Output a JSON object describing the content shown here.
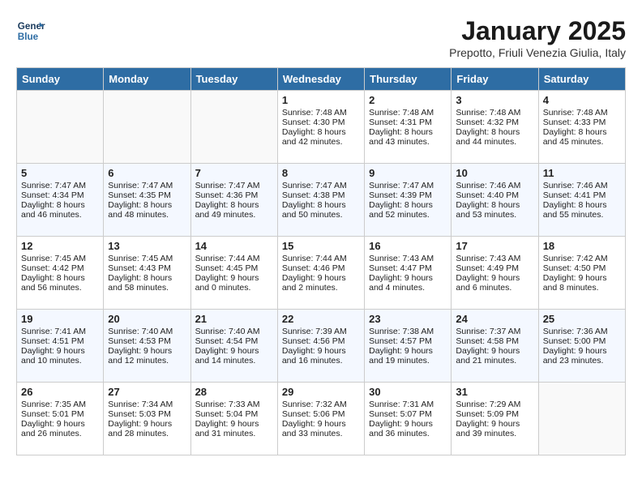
{
  "header": {
    "logo_line1": "General",
    "logo_line2": "Blue",
    "month": "January 2025",
    "location": "Prepotto, Friuli Venezia Giulia, Italy"
  },
  "days_of_week": [
    "Sunday",
    "Monday",
    "Tuesday",
    "Wednesday",
    "Thursday",
    "Friday",
    "Saturday"
  ],
  "weeks": [
    [
      {
        "day": "",
        "content": ""
      },
      {
        "day": "",
        "content": ""
      },
      {
        "day": "",
        "content": ""
      },
      {
        "day": "1",
        "content": "Sunrise: 7:48 AM\nSunset: 4:30 PM\nDaylight: 8 hours and 42 minutes."
      },
      {
        "day": "2",
        "content": "Sunrise: 7:48 AM\nSunset: 4:31 PM\nDaylight: 8 hours and 43 minutes."
      },
      {
        "day": "3",
        "content": "Sunrise: 7:48 AM\nSunset: 4:32 PM\nDaylight: 8 hours and 44 minutes."
      },
      {
        "day": "4",
        "content": "Sunrise: 7:48 AM\nSunset: 4:33 PM\nDaylight: 8 hours and 45 minutes."
      }
    ],
    [
      {
        "day": "5",
        "content": "Sunrise: 7:47 AM\nSunset: 4:34 PM\nDaylight: 8 hours and 46 minutes."
      },
      {
        "day": "6",
        "content": "Sunrise: 7:47 AM\nSunset: 4:35 PM\nDaylight: 8 hours and 48 minutes."
      },
      {
        "day": "7",
        "content": "Sunrise: 7:47 AM\nSunset: 4:36 PM\nDaylight: 8 hours and 49 minutes."
      },
      {
        "day": "8",
        "content": "Sunrise: 7:47 AM\nSunset: 4:38 PM\nDaylight: 8 hours and 50 minutes."
      },
      {
        "day": "9",
        "content": "Sunrise: 7:47 AM\nSunset: 4:39 PM\nDaylight: 8 hours and 52 minutes."
      },
      {
        "day": "10",
        "content": "Sunrise: 7:46 AM\nSunset: 4:40 PM\nDaylight: 8 hours and 53 minutes."
      },
      {
        "day": "11",
        "content": "Sunrise: 7:46 AM\nSunset: 4:41 PM\nDaylight: 8 hours and 55 minutes."
      }
    ],
    [
      {
        "day": "12",
        "content": "Sunrise: 7:45 AM\nSunset: 4:42 PM\nDaylight: 8 hours and 56 minutes."
      },
      {
        "day": "13",
        "content": "Sunrise: 7:45 AM\nSunset: 4:43 PM\nDaylight: 8 hours and 58 minutes."
      },
      {
        "day": "14",
        "content": "Sunrise: 7:44 AM\nSunset: 4:45 PM\nDaylight: 9 hours and 0 minutes."
      },
      {
        "day": "15",
        "content": "Sunrise: 7:44 AM\nSunset: 4:46 PM\nDaylight: 9 hours and 2 minutes."
      },
      {
        "day": "16",
        "content": "Sunrise: 7:43 AM\nSunset: 4:47 PM\nDaylight: 9 hours and 4 minutes."
      },
      {
        "day": "17",
        "content": "Sunrise: 7:43 AM\nSunset: 4:49 PM\nDaylight: 9 hours and 6 minutes."
      },
      {
        "day": "18",
        "content": "Sunrise: 7:42 AM\nSunset: 4:50 PM\nDaylight: 9 hours and 8 minutes."
      }
    ],
    [
      {
        "day": "19",
        "content": "Sunrise: 7:41 AM\nSunset: 4:51 PM\nDaylight: 9 hours and 10 minutes."
      },
      {
        "day": "20",
        "content": "Sunrise: 7:40 AM\nSunset: 4:53 PM\nDaylight: 9 hours and 12 minutes."
      },
      {
        "day": "21",
        "content": "Sunrise: 7:40 AM\nSunset: 4:54 PM\nDaylight: 9 hours and 14 minutes."
      },
      {
        "day": "22",
        "content": "Sunrise: 7:39 AM\nSunset: 4:56 PM\nDaylight: 9 hours and 16 minutes."
      },
      {
        "day": "23",
        "content": "Sunrise: 7:38 AM\nSunset: 4:57 PM\nDaylight: 9 hours and 19 minutes."
      },
      {
        "day": "24",
        "content": "Sunrise: 7:37 AM\nSunset: 4:58 PM\nDaylight: 9 hours and 21 minutes."
      },
      {
        "day": "25",
        "content": "Sunrise: 7:36 AM\nSunset: 5:00 PM\nDaylight: 9 hours and 23 minutes."
      }
    ],
    [
      {
        "day": "26",
        "content": "Sunrise: 7:35 AM\nSunset: 5:01 PM\nDaylight: 9 hours and 26 minutes."
      },
      {
        "day": "27",
        "content": "Sunrise: 7:34 AM\nSunset: 5:03 PM\nDaylight: 9 hours and 28 minutes."
      },
      {
        "day": "28",
        "content": "Sunrise: 7:33 AM\nSunset: 5:04 PM\nDaylight: 9 hours and 31 minutes."
      },
      {
        "day": "29",
        "content": "Sunrise: 7:32 AM\nSunset: 5:06 PM\nDaylight: 9 hours and 33 minutes."
      },
      {
        "day": "30",
        "content": "Sunrise: 7:31 AM\nSunset: 5:07 PM\nDaylight: 9 hours and 36 minutes."
      },
      {
        "day": "31",
        "content": "Sunrise: 7:29 AM\nSunset: 5:09 PM\nDaylight: 9 hours and 39 minutes."
      },
      {
        "day": "",
        "content": ""
      }
    ]
  ]
}
